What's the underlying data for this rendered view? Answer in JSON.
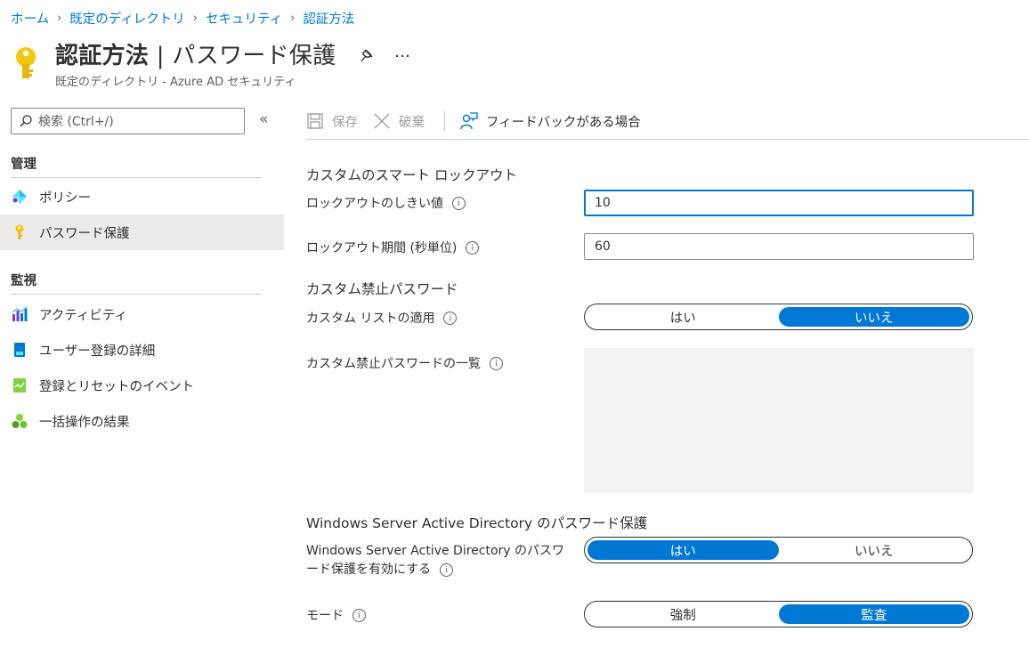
{
  "breadcrumb": [
    "ホーム",
    "既定のディレクトリ",
    "セキュリティ",
    "認証方法"
  ],
  "header": {
    "title_bold": "認証方法",
    "title_rest": " | パスワード保護",
    "subtitle": "既定のディレクトリ - Azure AD セキュリティ",
    "more": "…"
  },
  "search": {
    "placeholder": "検索 (Ctrl+/)",
    "collapse": "«"
  },
  "sidebar": {
    "sections": [
      {
        "heading": "管理",
        "items": [
          {
            "label": "ポリシー",
            "icon": "policy-icon"
          },
          {
            "label": "パスワード保護",
            "icon": "key-icon",
            "active": true
          }
        ]
      },
      {
        "heading": "監視",
        "items": [
          {
            "label": "アクティビティ",
            "icon": "activity-chart-icon"
          },
          {
            "label": "ユーザー登録の詳細",
            "icon": "user-registration-icon"
          },
          {
            "label": "登録とリセットのイベント",
            "icon": "events-icon"
          },
          {
            "label": "一括操作の結果",
            "icon": "bulk-operations-icon"
          }
        ]
      }
    ]
  },
  "toolbar": {
    "save": "保存",
    "discard": "破棄",
    "feedback": "フィードバックがある場合"
  },
  "form": {
    "smart_lockout": {
      "heading": "カスタムのスマート ロックアウト",
      "threshold_label": "ロックアウトのしきい値",
      "threshold_value": "10",
      "duration_label": "ロックアウト期間 (秒単位)",
      "duration_value": "60"
    },
    "banned": {
      "heading": "カスタム禁止パスワード",
      "enforce_label": "カスタム リストの適用",
      "enforce_options": [
        "はい",
        "いいえ"
      ],
      "enforce_selected": "いいえ",
      "list_label": "カスタム禁止パスワードの一覧"
    },
    "windows": {
      "heading": "Windows Server Active Directory のパスワード保護",
      "enable_label": "Windows Server Active Directory のパスワード保護を有効にする",
      "enable_options": [
        "はい",
        "いいえ"
      ],
      "enable_selected": "はい",
      "mode_label": "モード",
      "mode_options": [
        "強制",
        "監査"
      ],
      "mode_selected": "監査"
    },
    "info_glyph": "i"
  },
  "colors": {
    "accent": "#0078d4",
    "active_nav": "#edebe9",
    "key_gold": "#f2c811"
  }
}
